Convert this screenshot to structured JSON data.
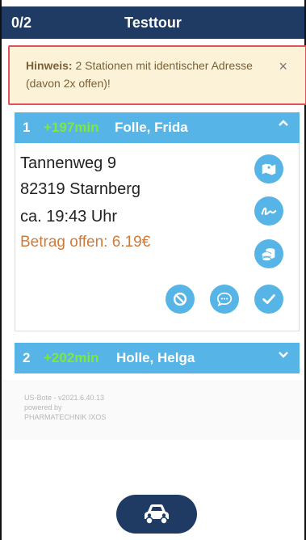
{
  "header": {
    "counter": "0/2",
    "title": "Testtour"
  },
  "notice": {
    "label": "Hinweis:",
    "message": " 2 Stationen mit identischer Adresse (davon 2x offen)!",
    "close_glyph": "×"
  },
  "stops": [
    {
      "number": "1",
      "delay": "+197min",
      "name": "Folle, Frida",
      "expanded": true,
      "street": "Tannenweg 9",
      "city": "82319 Starnberg",
      "eta": "ca. 19:43 Uhr",
      "amount_due": "Betrag offen: 6.19€"
    },
    {
      "number": "2",
      "delay": "+202min",
      "name": "Holle, Helga",
      "expanded": false
    }
  ],
  "footer": {
    "line1": "US-Bote - v2021.6.40.13",
    "line2": "powered by",
    "line3": "PHARMATECHNIK IXOS"
  },
  "colors": {
    "header_bg": "#1f3a63",
    "card_header_bg": "#56b5e6",
    "delay_green": "#7ee83c",
    "notice_bg": "#fcf2d8",
    "notice_border": "#e0525a",
    "amount_due": "#d07a3a"
  },
  "icons": [
    "map-icon",
    "signature-icon",
    "coins-icon",
    "cancel-icon",
    "comment-icon",
    "check-icon",
    "car-icon",
    "chevron-up-icon",
    "chevron-down-icon",
    "close-icon"
  ]
}
